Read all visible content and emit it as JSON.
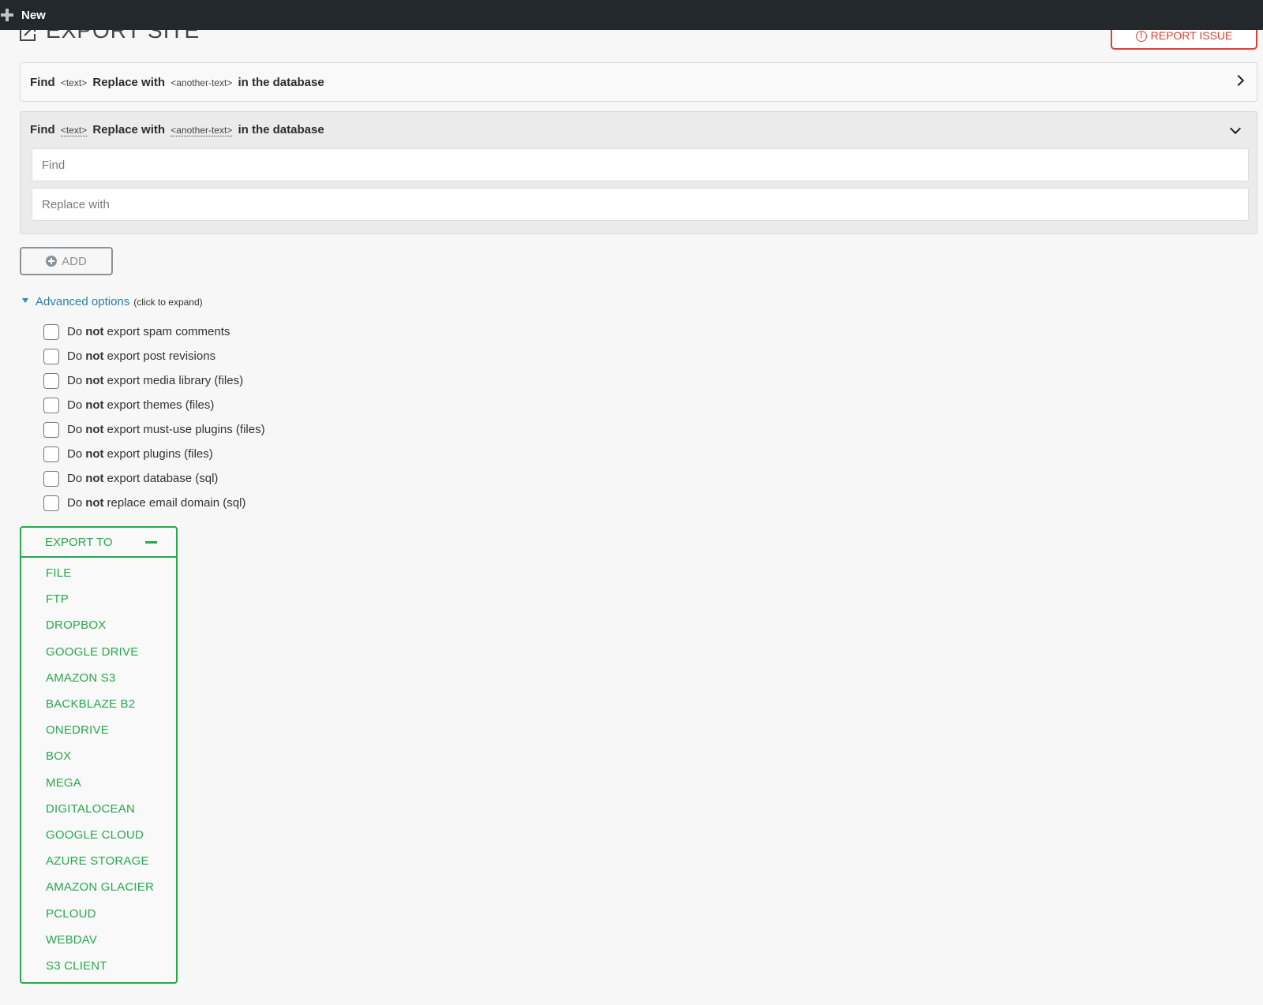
{
  "adminbar": {
    "new_label": "New"
  },
  "header": {
    "title": "EXPORT SITE",
    "report_issue_label": "REPORT ISSUE"
  },
  "find_replace": {
    "find_word": "Find",
    "text_token": "<text>",
    "replace_word": "Replace with",
    "another_token": "<another-text>",
    "suffix": "in the database",
    "find_placeholder": "Find",
    "replace_placeholder": "Replace with"
  },
  "add_button_label": "ADD",
  "advanced": {
    "label": "Advanced options",
    "hint": "(click to expand)",
    "options": [
      {
        "pre": "Do",
        "bold": "not",
        "post": "export spam comments"
      },
      {
        "pre": "Do",
        "bold": "not",
        "post": "export post revisions"
      },
      {
        "pre": "Do",
        "bold": "not",
        "post": "export media library (files)"
      },
      {
        "pre": "Do",
        "bold": "not",
        "post": "export themes (files)"
      },
      {
        "pre": "Do",
        "bold": "not",
        "post": "export must-use plugins (files)"
      },
      {
        "pre": "Do",
        "bold": "not",
        "post": "export plugins (files)"
      },
      {
        "pre": "Do",
        "bold": "not",
        "post": "export database (sql)"
      },
      {
        "pre": "Do",
        "bold": "not",
        "post": "replace email domain (sql)"
      }
    ]
  },
  "export_to": {
    "label": "EXPORT TO",
    "items": [
      "FILE",
      "FTP",
      "DROPBOX",
      "GOOGLE DRIVE",
      "AMAZON S3",
      "BACKBLAZE B2",
      "ONEDRIVE",
      "BOX",
      "MEGA",
      "DIGITALOCEAN",
      "GOOGLE CLOUD",
      "AZURE STORAGE",
      "AMAZON GLACIER",
      "PCLOUD",
      "WEBDAV",
      "S3 CLIENT"
    ]
  },
  "colors": {
    "adminbar": "#23282d",
    "report_red": "#e0402f",
    "export_green": "#27a84b",
    "link_blue": "#2a7fa6"
  }
}
